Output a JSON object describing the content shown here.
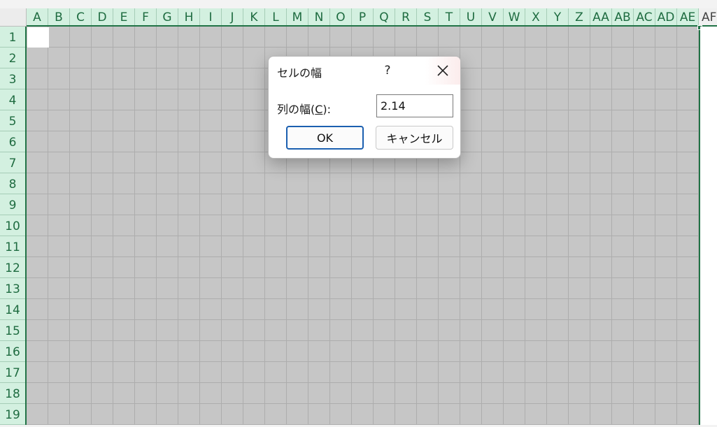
{
  "spreadsheet": {
    "columns": [
      "A",
      "B",
      "C",
      "D",
      "E",
      "F",
      "G",
      "H",
      "I",
      "J",
      "K",
      "L",
      "M",
      "N",
      "O",
      "P",
      "Q",
      "R",
      "S",
      "T",
      "U",
      "V",
      "W",
      "X",
      "Y",
      "Z",
      "AA",
      "AB",
      "AC",
      "AD",
      "AE"
    ],
    "offscreen_column": "AF",
    "rows": [
      "1",
      "2",
      "3",
      "4",
      "5",
      "6",
      "7",
      "8",
      "9",
      "10",
      "11",
      "12",
      "13",
      "14",
      "15",
      "16",
      "17",
      "18",
      "19"
    ],
    "selection_color": "#217346",
    "header_text_color": "#1e6b40"
  },
  "dialog": {
    "title": "セルの幅",
    "help_label": "?",
    "close_icon": "close-icon",
    "field_label_prefix": "列の幅(",
    "field_label_accel": "C",
    "field_label_suffix": "):",
    "column_width_value": "2.14",
    "ok_label": "OK",
    "cancel_label": "キャンセル"
  }
}
